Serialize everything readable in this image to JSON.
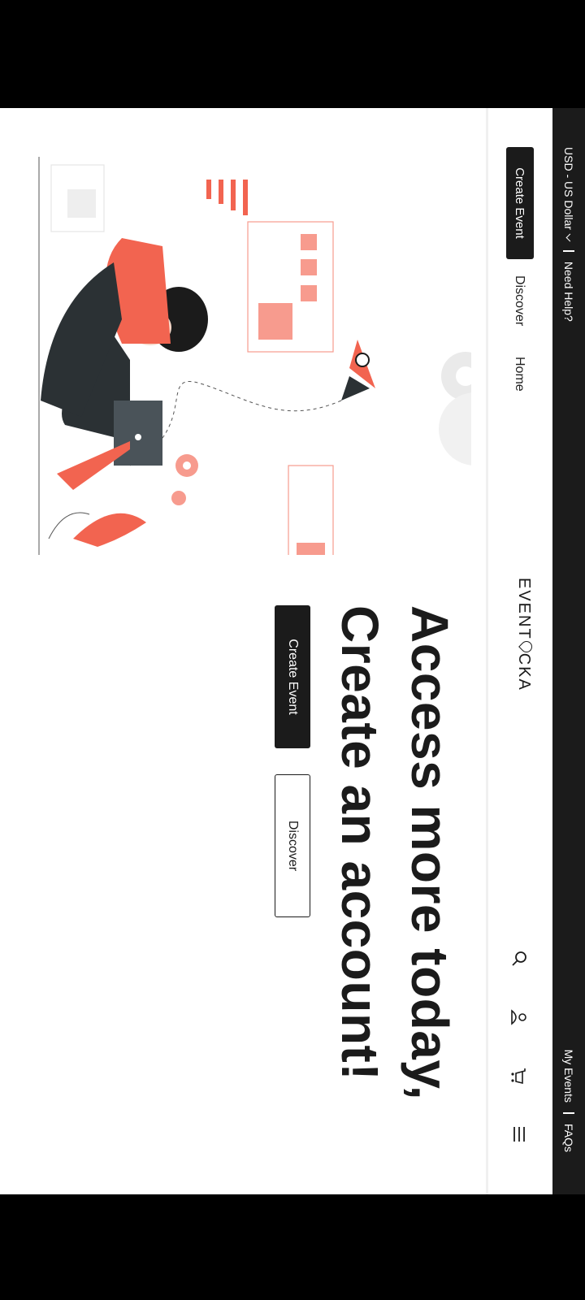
{
  "topbar": {
    "currency": "USD - US Dollar",
    "help": "Need Help?",
    "my_events": "My Events",
    "faqs": "FAQs"
  },
  "nav": {
    "create_event": "Create Event",
    "discover": "Discover",
    "home": "Home",
    "logo_left": "EVENT",
    "logo_right": "CKA",
    "icons": [
      "search-icon",
      "user-icon",
      "cart-icon",
      "menu-icon"
    ]
  },
  "hero": {
    "line1": "Access more today,",
    "line2": "Create an account!",
    "primary_button": "Create Event",
    "secondary_button": "Discover"
  },
  "colors": {
    "dark": "#1b1b1b",
    "accent": "#f26450",
    "accent_light": "#f79b8e"
  }
}
